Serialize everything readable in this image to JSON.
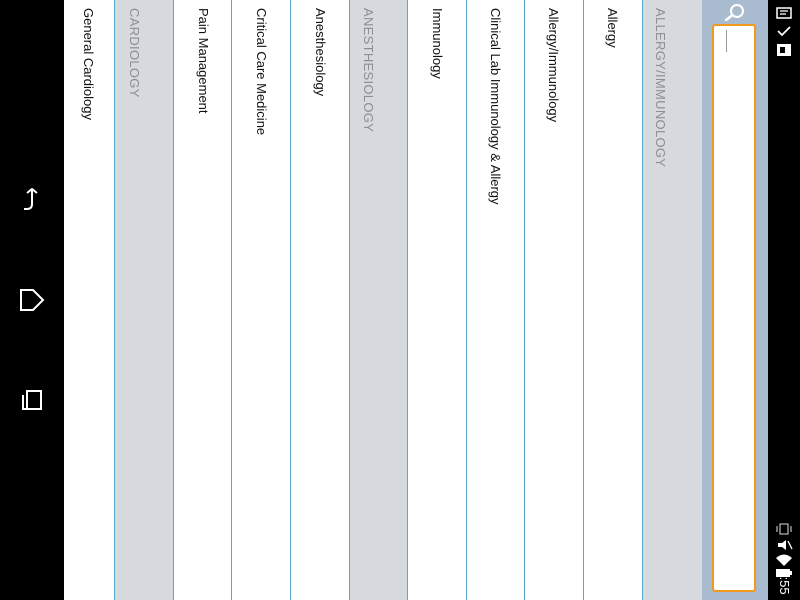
{
  "search": {
    "placeholder": ""
  },
  "list": {
    "rows": [
      {
        "label": "General Cardiology",
        "type": "item"
      },
      {
        "label": "CARDIOLOGY",
        "type": "header"
      },
      {
        "label": "Pain Management",
        "type": "item"
      },
      {
        "label": "Critical Care Medicine",
        "type": "item"
      },
      {
        "label": "Anesthesiology",
        "type": "item"
      },
      {
        "label": "ANESTHESIOLOGY",
        "type": "header"
      },
      {
        "label": "Immunology",
        "type": "item"
      },
      {
        "label": "Clinical Lab Immunology & Allergy",
        "type": "item"
      },
      {
        "label": "Allergy/Immunology",
        "type": "item"
      },
      {
        "label": "Allergy",
        "type": "item"
      },
      {
        "label": "ALLERGY/IMMUNOLOGY",
        "type": "header"
      }
    ]
  },
  "status": {
    "time": "3:55"
  },
  "colors": {
    "accent": "#f29a1e",
    "divider": "#5aa7cf",
    "header_bg": "#d6dade",
    "search_bg": "#a9bccf"
  }
}
